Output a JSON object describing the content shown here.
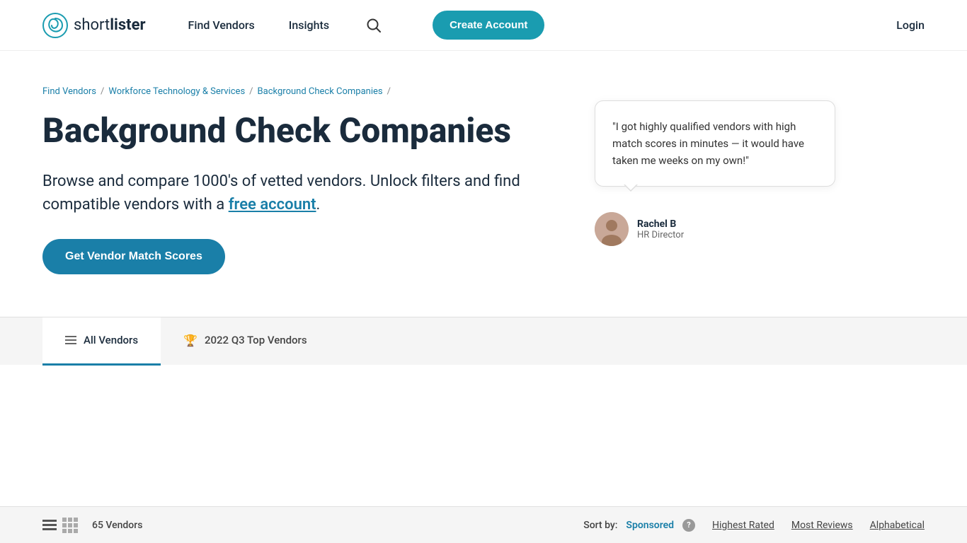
{
  "header": {
    "logo_text_light": "short",
    "logo_text_bold": "lister",
    "nav": {
      "find_vendors": "Find Vendors",
      "insights": "Insights"
    },
    "create_account": "Create Account",
    "login": "Login"
  },
  "breadcrumb": {
    "item1": "Find Vendors",
    "item2": "Workforce Technology & Services",
    "item3": "Background Check Companies"
  },
  "hero": {
    "page_title": "Background Check Companies",
    "description_start": "Browse and compare 1000's of vetted vendors. Unlock filters and find compatible vendors with a ",
    "free_account_link": "free account",
    "description_end": ".",
    "cta_button": "Get Vendor Match Scores"
  },
  "testimonial": {
    "quote": "\"I got highly qualified vendors with high match scores in minutes — it would have taken me weeks on my own!\"",
    "author_name": "Rachel B",
    "author_title": "HR Director"
  },
  "tabs": {
    "all_vendors": "All Vendors",
    "top_vendors": "2022 Q3 Top Vendors"
  },
  "bottom_bar": {
    "vendor_count": "65 Vendors",
    "sort_label": "Sort by:",
    "sort_sponsored": "Sponsored",
    "sort_highest_rated": "Highest Rated",
    "sort_most_reviews": "Most Reviews",
    "sort_alphabetical": "Alphabetical"
  },
  "colors": {
    "primary_blue": "#1a7fa8",
    "teal": "#1a9cb0",
    "dark": "#1a2b3c"
  }
}
